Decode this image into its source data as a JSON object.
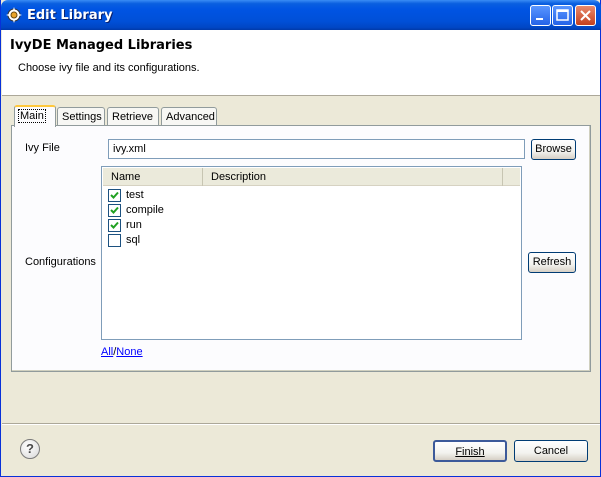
{
  "window": {
    "title": "Edit Library"
  },
  "header": {
    "title": "IvyDE Managed Libraries",
    "description": "Choose ivy file and its configurations."
  },
  "tabs": [
    {
      "label": "Main",
      "active": true
    },
    {
      "label": "Settings",
      "active": false
    },
    {
      "label": "Retrieve",
      "active": false
    },
    {
      "label": "Advanced",
      "active": false
    }
  ],
  "main": {
    "ivy_file_label": "Ivy File",
    "ivy_file_value": "ivy.xml",
    "browse_label": "Browse",
    "configurations_label": "Configurations",
    "refresh_label": "Refresh",
    "table": {
      "columns": [
        "Name",
        "Description"
      ],
      "rows": [
        {
          "name": "test",
          "description": "",
          "checked": true
        },
        {
          "name": "compile",
          "description": "",
          "checked": true
        },
        {
          "name": "run",
          "description": "",
          "checked": true
        },
        {
          "name": "sql",
          "description": "",
          "checked": false
        }
      ]
    },
    "all_link": "All",
    "separator": "/",
    "none_link": "None"
  },
  "footer": {
    "help_icon": "help-icon",
    "finish_label": "Finish",
    "cancel_label": "Cancel"
  },
  "colors": {
    "titlebar": "#0054e3",
    "check": "#21a121",
    "link": "#0000ff"
  }
}
